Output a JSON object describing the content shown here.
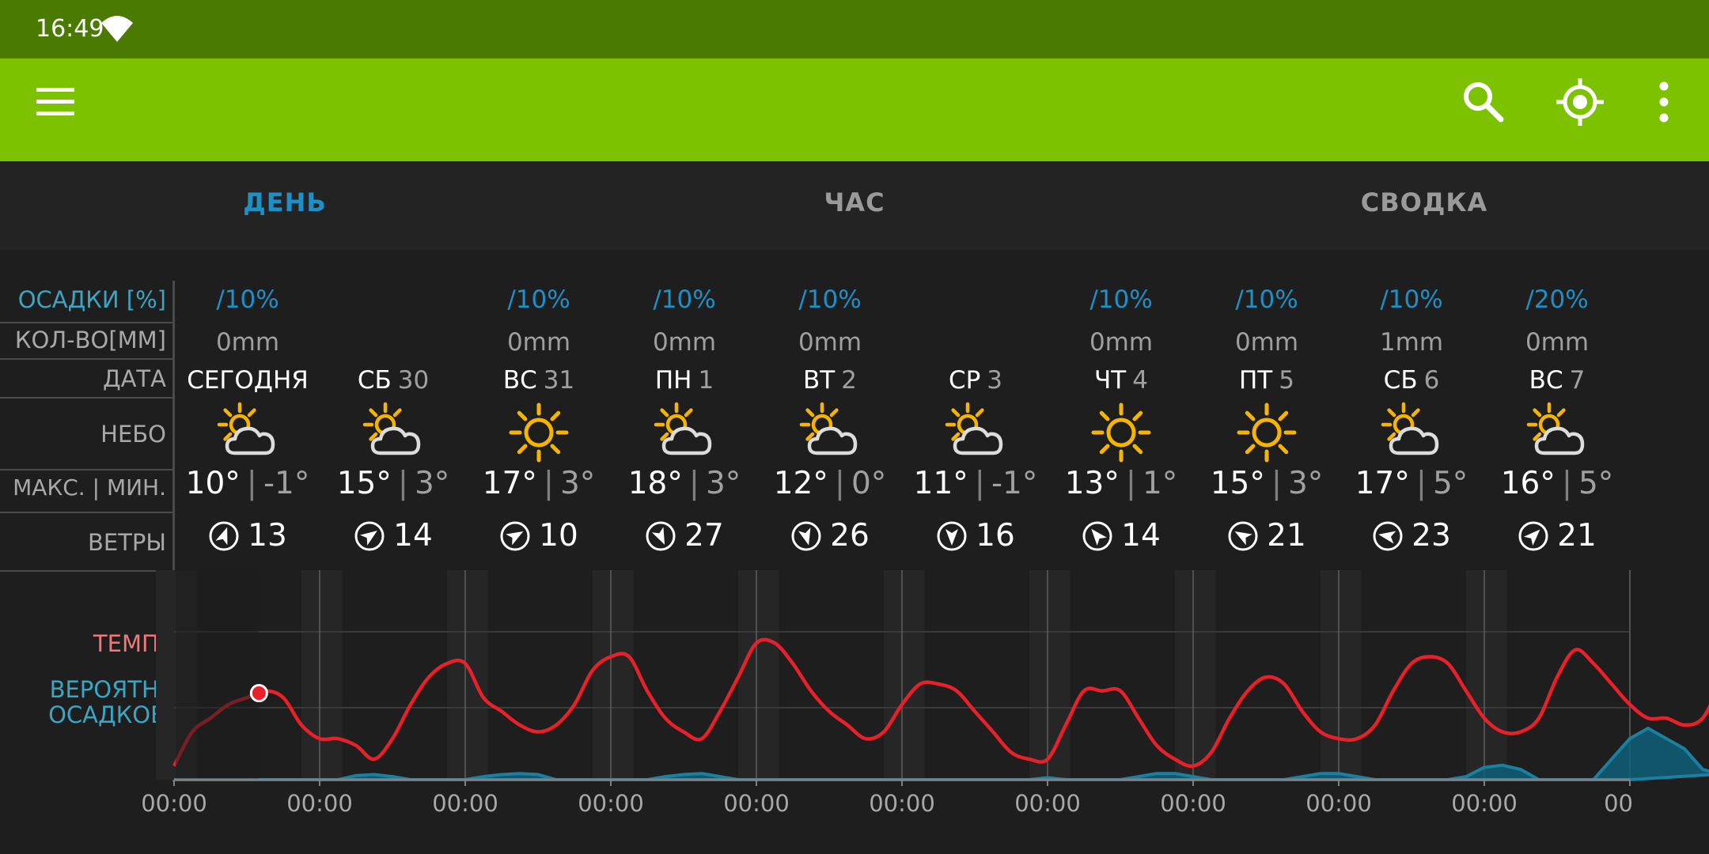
{
  "status_bar": {
    "time": "16:49"
  },
  "app_bar": {
    "menu_icon": "menu-icon",
    "search_icon": "search-icon",
    "locate_icon": "my-location-icon",
    "overflow_icon": "more-vert-icon"
  },
  "tabs": [
    {
      "label": "ДЕНЬ",
      "active": true
    },
    {
      "label": "ЧАС",
      "active": false
    },
    {
      "label": "СВОДКА",
      "active": false
    }
  ],
  "row_labels": {
    "precip_prob": "ОСАДКИ [%]",
    "precip_amount": "КОЛ-ВО[ММ]",
    "date": "ДАТА",
    "sky": "НЕБО",
    "temps": "МАКС. | МИН.",
    "winds": "ВЕТРЫ",
    "chart_temp": "ТЕМП.",
    "chart_precip_1": "ВЕРОЯТН.",
    "chart_precip_2": "ОСАДКОВ"
  },
  "colors": {
    "status_bar": "#4a7a00",
    "app_bar": "#7dc200",
    "accent_blue": "#1e90c8",
    "temp_line": "#e8202a",
    "precip_fill": "#0e5f77",
    "sun": "#f5b400"
  },
  "days": [
    {
      "dow": "СЕГОДНЯ",
      "date": "",
      "precip": "10%",
      "amount": "0mm",
      "sky": "partly-cloudy",
      "max": "10°",
      "min": "-1°",
      "wind": "13",
      "wind_dir": 20
    },
    {
      "dow": "СБ",
      "date": "30",
      "precip": "",
      "amount": "",
      "sky": "partly-cloudy",
      "max": "15°",
      "min": "3°",
      "wind": "14",
      "wind_dir": 55
    },
    {
      "dow": "ВС",
      "date": "31",
      "precip": "10%",
      "amount": "0mm",
      "sky": "sunny",
      "max": "17°",
      "min": "3°",
      "wind": "10",
      "wind_dir": 60
    },
    {
      "dow": "ПН",
      "date": "1",
      "precip": "10%",
      "amount": "0mm",
      "sky": "partly-cloudy",
      "max": "18°",
      "min": "3°",
      "wind": "27",
      "wind_dir": 155
    },
    {
      "dow": "ВТ",
      "date": "2",
      "precip": "10%",
      "amount": "0mm",
      "sky": "partly-cloudy",
      "max": "12°",
      "min": "0°",
      "wind": "26",
      "wind_dir": 165
    },
    {
      "dow": "СР",
      "date": "3",
      "precip": "",
      "amount": "",
      "sky": "partly-cloudy",
      "max": "11°",
      "min": "-1°",
      "wind": "16",
      "wind_dir": 180
    },
    {
      "dow": "ЧТ",
      "date": "4",
      "precip": "10%",
      "amount": "0mm",
      "sky": "sunny",
      "max": "13°",
      "min": "1°",
      "wind": "14",
      "wind_dir": -40
    },
    {
      "dow": "ПТ",
      "date": "5",
      "precip": "10%",
      "amount": "0mm",
      "sky": "sunny",
      "max": "15°",
      "min": "3°",
      "wind": "21",
      "wind_dir": -60
    },
    {
      "dow": "СБ",
      "date": "6",
      "precip": "10%",
      "amount": "1mm",
      "sky": "partly-cloudy",
      "max": "17°",
      "min": "5°",
      "wind": "23",
      "wind_dir": -80
    },
    {
      "dow": "ВС",
      "date": "7",
      "precip": "20%",
      "amount": "0mm",
      "sky": "partly-cloudy",
      "max": "16°",
      "min": "5°",
      "wind": "21",
      "wind_dir": 45
    }
  ],
  "chart_data": {
    "type": "line",
    "x_tick_labels": [
      "00:00",
      "00:00",
      "00:00",
      "00:00",
      "00:00",
      "00:00",
      "00:00",
      "00:00",
      "00:00",
      "00:00",
      "00"
    ],
    "ylim": [
      -3,
      22
    ],
    "current_marker": {
      "day": 0,
      "hour": 14
    },
    "series": [
      {
        "key": "temp",
        "step_hours": 3,
        "values": [
          -1,
          4,
          6,
          8,
          9,
          10,
          9,
          5,
          3,
          3,
          2,
          0,
          3,
          8,
          12,
          14,
          14,
          9,
          7,
          5,
          4,
          5,
          8,
          13,
          15,
          15,
          10,
          6,
          4,
          3,
          7,
          12,
          17,
          17,
          14,
          10,
          7,
          5,
          3,
          4,
          8,
          11,
          11,
          10,
          7,
          4,
          1,
          0,
          0,
          5,
          10,
          10,
          10,
          6,
          2,
          0,
          -1,
          1,
          6,
          10,
          12,
          11,
          7,
          4,
          3,
          3,
          5,
          10,
          14,
          15,
          14,
          10,
          6,
          4,
          4,
          6,
          12,
          16,
          14,
          11,
          8,
          6,
          6,
          5,
          6,
          11,
          15,
          15,
          11,
          9
        ]
      },
      {
        "key": "precip",
        "step_hours": 3,
        "values": [
          0,
          0,
          0,
          0,
          0,
          0,
          0,
          0,
          0,
          0,
          4,
          5,
          3,
          0,
          0,
          0,
          0,
          3,
          5,
          6,
          5,
          0,
          0,
          0,
          0,
          0,
          0,
          3,
          5,
          6,
          3,
          0,
          0,
          0,
          0,
          0,
          0,
          0,
          0,
          0,
          0,
          0,
          0,
          0,
          0,
          0,
          0,
          0,
          2,
          0,
          0,
          0,
          0,
          3,
          6,
          6,
          3,
          0,
          0,
          0,
          0,
          0,
          3,
          6,
          6,
          3,
          0,
          0,
          0,
          0,
          0,
          3,
          12,
          14,
          10,
          0,
          0,
          0,
          0,
          20,
          40,
          50,
          40,
          30,
          10,
          5,
          0,
          0,
          10,
          10
        ]
      }
    ]
  }
}
